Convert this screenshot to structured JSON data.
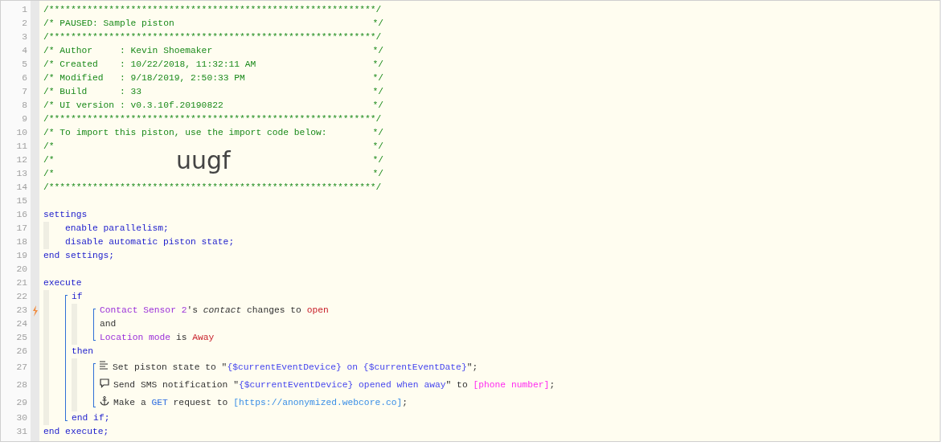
{
  "import_code": "uugf",
  "code": [
    {
      "number": "1",
      "trigger": false,
      "tokens": [
        {
          "text": "/************************************************************/",
          "kind": "comment"
        }
      ]
    },
    {
      "number": "2",
      "trigger": false,
      "tokens": [
        {
          "text": "/* PAUSED: Sample piston",
          "kind": "comment"
        },
        {
          "text": "*/",
          "kind": "comment_end"
        }
      ]
    },
    {
      "number": "3",
      "trigger": false,
      "tokens": [
        {
          "text": "/************************************************************/",
          "kind": "comment"
        }
      ]
    },
    {
      "number": "4",
      "trigger": false,
      "tokens": [
        {
          "text": "/* Author     : Kevin Shoemaker",
          "kind": "comment"
        },
        {
          "text": "*/",
          "kind": "comment_end"
        }
      ]
    },
    {
      "number": "5",
      "trigger": false,
      "tokens": [
        {
          "text": "/* Created    : 10/22/2018, 11:32:11 AM",
          "kind": "comment"
        },
        {
          "text": "*/",
          "kind": "comment_end"
        }
      ]
    },
    {
      "number": "6",
      "trigger": false,
      "tokens": [
        {
          "text": "/* Modified   : 9/18/2019, 2:50:33 PM",
          "kind": "comment"
        },
        {
          "text": "*/",
          "kind": "comment_end"
        }
      ]
    },
    {
      "number": "7",
      "trigger": false,
      "tokens": [
        {
          "text": "/* Build      : 33",
          "kind": "comment"
        },
        {
          "text": "*/",
          "kind": "comment_end"
        }
      ]
    },
    {
      "number": "8",
      "trigger": false,
      "tokens": [
        {
          "text": "/* UI version : v0.3.10f.20190822",
          "kind": "comment"
        },
        {
          "text": "*/",
          "kind": "comment_end"
        }
      ]
    },
    {
      "number": "9",
      "trigger": false,
      "tokens": [
        {
          "text": "/************************************************************/",
          "kind": "comment"
        }
      ]
    },
    {
      "number": "10",
      "trigger": false,
      "tokens": [
        {
          "text": "/* To import this piston, use the import code below:",
          "kind": "comment"
        },
        {
          "text": "*/",
          "kind": "comment_end"
        }
      ]
    },
    {
      "number": "11",
      "trigger": false,
      "tokens": [
        {
          "text": "/*",
          "kind": "comment"
        },
        {
          "text": "*/",
          "kind": "comment_end"
        }
      ]
    },
    {
      "number": "12",
      "trigger": false,
      "tokens": [
        {
          "text": "/*",
          "kind": "comment"
        },
        {
          "text": "*/",
          "kind": "comment_end"
        }
      ]
    },
    {
      "number": "13",
      "trigger": false,
      "tokens": [
        {
          "text": "/*",
          "kind": "comment"
        },
        {
          "text": "*/",
          "kind": "comment_end"
        }
      ]
    },
    {
      "number": "14",
      "trigger": false,
      "tokens": [
        {
          "text": "/************************************************************/",
          "kind": "comment"
        }
      ]
    },
    {
      "number": "15",
      "trigger": false
    },
    {
      "number": "16",
      "trigger": false,
      "tokens": [
        {
          "text": "settings",
          "kind": "keyword"
        }
      ],
      "children": [
        {
          "number": "17",
          "trigger": false,
          "tokens": [
            {
              "text": "enable parallelism;",
              "kind": "keyword"
            }
          ]
        },
        {
          "number": "18",
          "trigger": false,
          "tokens": [
            {
              "text": "disable automatic piston state;",
              "kind": "keyword"
            }
          ]
        }
      ]
    },
    {
      "number": "19",
      "trigger": false,
      "tokens": [
        {
          "text": "end settings;",
          "kind": "keyword"
        }
      ]
    },
    {
      "number": "20",
      "trigger": false
    },
    {
      "number": "21",
      "trigger": false,
      "tokens": [
        {
          "text": "execute",
          "kind": "keyword"
        }
      ],
      "children": [
        {
          "children": [
            {
              "number": "22",
              "trigger": false,
              "tokens": [
                {
                  "text": "if",
                  "kind": "keyword"
                }
              ],
              "children": [
                {
                  "children": [
                    {
                      "number": "23",
                      "trigger": true,
                      "tokens": [
                        {
                          "text": "Contact Sensor 2",
                          "kind": "device"
                        },
                        {
                          "text": "'s ",
                          "kind": "plain"
                        },
                        {
                          "text": "contact",
                          "kind": "attribute"
                        },
                        {
                          "text": " changes to ",
                          "kind": "plain"
                        },
                        {
                          "text": "open",
                          "kind": "value"
                        }
                      ]
                    },
                    {
                      "number": "24",
                      "trigger": false,
                      "tokens": [
                        {
                          "text": "and",
                          "kind": "plain"
                        }
                      ]
                    },
                    {
                      "number": "25",
                      "trigger": false,
                      "tokens": [
                        {
                          "text": "Location mode",
                          "kind": "device"
                        },
                        {
                          "text": " is ",
                          "kind": "plain"
                        },
                        {
                          "text": "Away",
                          "kind": "value"
                        }
                      ]
                    }
                  ]
                }
              ]
            },
            {
              "number": "26",
              "trigger": false,
              "tokens": [
                {
                  "text": "then",
                  "kind": "keyword"
                }
              ],
              "children": [
                {
                  "children": [
                    {
                      "number": "27",
                      "trigger": false,
                      "kind": "state",
                      "tokens": [
                        {
                          "text": "Set piston state to \"",
                          "kind": "plain"
                        },
                        {
                          "text": "{$currentEventDevice} on {$currentEventDate}",
                          "kind": "variable"
                        },
                        {
                          "text": "\";",
                          "kind": "plain"
                        }
                      ]
                    },
                    {
                      "number": "28",
                      "trigger": false,
                      "kind": "notification",
                      "tokens": [
                        {
                          "text": "Send SMS notification \"",
                          "kind": "plain"
                        },
                        {
                          "text": "{$currentEventDevice} opened when away",
                          "kind": "variable"
                        },
                        {
                          "text": "\" to ",
                          "kind": "plain"
                        },
                        {
                          "text": "[phone number]",
                          "kind": "phone"
                        },
                        {
                          "text": ";",
                          "kind": "plain"
                        }
                      ]
                    },
                    {
                      "number": "29",
                      "trigger": false,
                      "kind": "request",
                      "tokens": [
                        {
                          "text": "Make a ",
                          "kind": "plain"
                        },
                        {
                          "text": "GET",
                          "kind": "method"
                        },
                        {
                          "text": " request to ",
                          "kind": "plain"
                        },
                        {
                          "text": "[https://anonymized.webcore.co]",
                          "kind": "url"
                        },
                        {
                          "text": ";",
                          "kind": "plain"
                        }
                      ]
                    }
                  ]
                }
              ]
            },
            {
              "number": "30",
              "trigger": false,
              "tokens": [
                {
                  "text": "end if;",
                  "kind": "keyword"
                }
              ]
            }
          ]
        }
      ]
    },
    {
      "number": "31",
      "trigger": false,
      "tokens": [
        {
          "text": "end execute;",
          "kind": "keyword"
        }
      ]
    }
  ]
}
